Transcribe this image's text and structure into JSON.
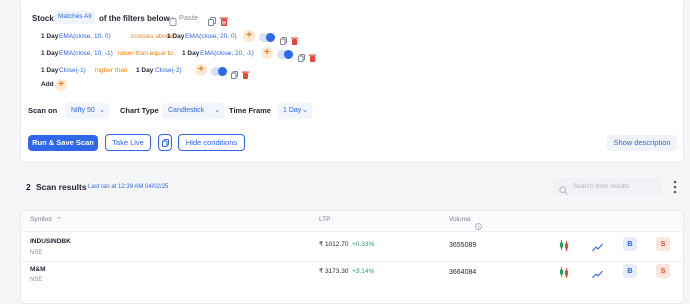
{
  "filter": {
    "stock_label": "Stock",
    "match_mode": "Matches All",
    "suffix": "of the filters below",
    "paste_label": "Paste",
    "conditions": [
      {
        "tf1": "1 Day",
        "ind1": "EMA(close, 10, 0)",
        "op": "crosses above",
        "tf2": "1 Day",
        "ind2": "EMA(close, 20, 0)"
      },
      {
        "tf1": "1 Day",
        "ind1": "EMA(close, 10, -1)",
        "op": "lower than equal to",
        "tf2": "1 Day",
        "ind2": "EMA(close, 20, -1)"
      },
      {
        "tf1": "1 Day",
        "ind1": "Close(-1)",
        "op": "higher than",
        "tf2": "1 Day",
        "ind2": "Close(-2)"
      }
    ],
    "add_label": "Add"
  },
  "scan_on": {
    "label": "Scan on",
    "value": "Nifty 50"
  },
  "chart_type": {
    "label": "Chart Type",
    "value": "Candlestick"
  },
  "time_frame": {
    "label": "Time Frame",
    "value": "1 Day"
  },
  "buttons": {
    "run_save": "Run & Save Scan",
    "take_live": "Take Live",
    "hide_conditions": "Hide conditions",
    "show_description": "Show description"
  },
  "results": {
    "count": "2",
    "title": "Scan results",
    "last_ran": "Last ran at 12:39 AM 04/02/25",
    "search_placeholder": "Search from results",
    "columns": {
      "symbol": "Symbol",
      "ltp": "LTP",
      "volume": "Volume"
    },
    "rows": [
      {
        "symbol": "INDUSINDBK",
        "exchange": "NSE",
        "ltp": "₹ 1012.70",
        "change": "+0.33%",
        "volume": "3655089",
        "buy": "B",
        "sell": "S"
      },
      {
        "symbol": "M&M",
        "exchange": "NSE",
        "ltp": "₹ 3173.30",
        "change": "+3.14%",
        "volume": "3664084",
        "buy": "B",
        "sell": "S"
      }
    ]
  },
  "colors": {
    "accent": "#2f67e8",
    "orange": "#f2820f",
    "green": "#25a45c",
    "buy_bg": "#e6ecfb",
    "sell_bg": "#fde4df",
    "sell_fg": "#e6502f"
  },
  "icons": [
    "copy-icon",
    "delete-icon",
    "paste-icon",
    "sort-arrow-icon",
    "info-icon",
    "search-icon",
    "more-icon",
    "candlestick-chart-icon",
    "line-chart-icon",
    "copy-scan-icon"
  ]
}
